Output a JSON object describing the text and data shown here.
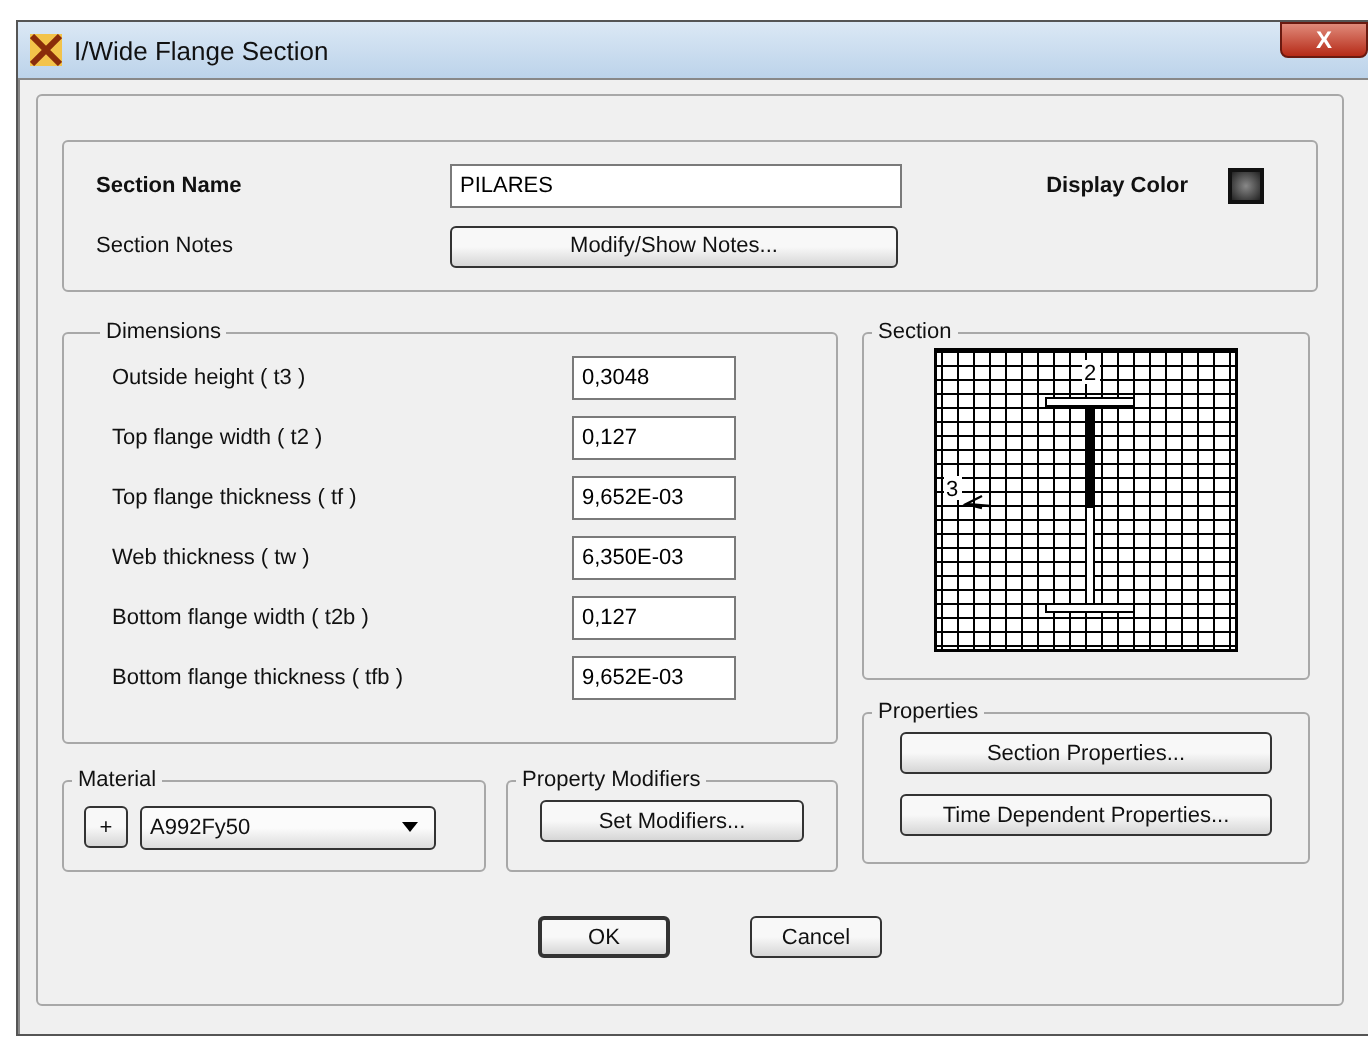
{
  "window": {
    "title": "I/Wide Flange Section",
    "close": "X"
  },
  "section_name": {
    "label": "Section Name",
    "value": "PILARES"
  },
  "display_color": {
    "label": "Display Color"
  },
  "section_notes": {
    "label": "Section Notes",
    "button": "Modify/Show Notes..."
  },
  "dimensions": {
    "title": "Dimensions",
    "rows": [
      {
        "label": "Outside height  ( t3 )",
        "value": "0,3048"
      },
      {
        "label": "Top flange width  ( t2 )",
        "value": "0,127"
      },
      {
        "label": "Top flange thickness  ( tf )",
        "value": "9,652E-03"
      },
      {
        "label": "Web thickness  ( tw )",
        "value": "6,350E-03"
      },
      {
        "label": "Bottom flange width  ( t2b )",
        "value": "0,127"
      },
      {
        "label": "Bottom flange thickness  ( tfb )",
        "value": "9,652E-03"
      }
    ]
  },
  "section": {
    "title": "Section",
    "axis_2": "2",
    "axis_3": "3"
  },
  "properties": {
    "title": "Properties",
    "buttons": [
      "Section Properties...",
      "Time Dependent Properties..."
    ]
  },
  "material": {
    "title": "Material",
    "add": "+",
    "value": "A992Fy50"
  },
  "property_modifiers": {
    "title": "Property Modifiers",
    "button": "Set Modifiers..."
  },
  "buttons": [
    "OK",
    "Cancel"
  ]
}
